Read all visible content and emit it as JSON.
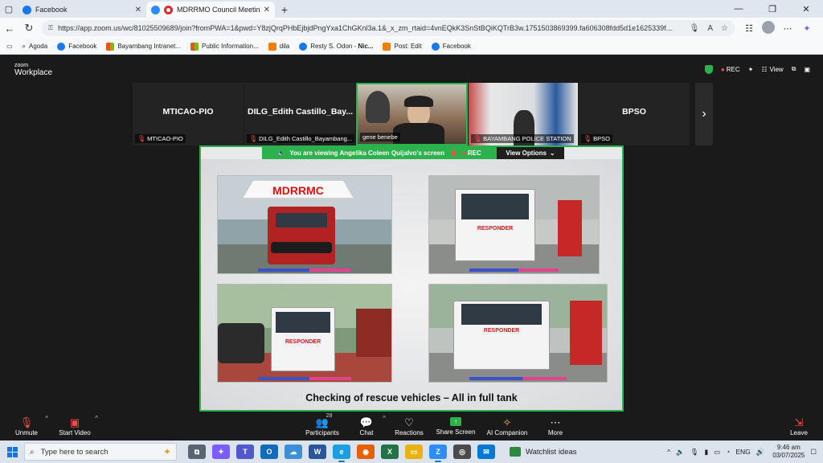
{
  "browser": {
    "tabs": [
      {
        "label": "Facebook",
        "close": "✕",
        "active": false,
        "color": "#1877f2"
      },
      {
        "label": "MDRRMO Council Meeting |",
        "close": "✕",
        "active": true,
        "color": "#2d8cff"
      }
    ],
    "new_tab": "+",
    "url": "https://app.zoom.us/wc/81025509689/join?fromPWA=1&pwd=Y8zjQrqPHbEjbjdPngYxa1ChGKnl3a.1&_x_zm_rtaid=4vnEQkK3SnStBQiKQTrB3w.1751503869399.fa606308fdd5d1e1625339f...",
    "bookmarks": [
      {
        "label": "Agoda",
        "icon": "search-icon",
        "color": "#888"
      },
      {
        "label": "Facebook",
        "icon": "facebook-icon",
        "color": "#1877f2"
      },
      {
        "label": "Bayambang Intranet...",
        "icon": "windows-icon",
        "color": "#f25022"
      },
      {
        "label": "Public Information...",
        "icon": "windows-icon",
        "color": "#f25022"
      },
      {
        "label": "dila",
        "icon": "blogger-icon",
        "color": "#f57d00"
      },
      {
        "label": "Resty S. Odon -",
        "bold": "Nic...",
        "icon": "facebook-icon",
        "color": "#1877f2"
      },
      {
        "label": "Post: Edit",
        "icon": "blogger-icon",
        "color": "#f57d00"
      },
      {
        "label": "Facebook",
        "icon": "facebook-icon",
        "color": "#1877f2"
      }
    ]
  },
  "zoom": {
    "logo_top": "zoom",
    "logo_bottom": "Workplace",
    "rec": "REC",
    "view": "View",
    "participants_strip": [
      {
        "name": "MTICAO-PIO",
        "label": "MTICAO-PIO",
        "video": false
      },
      {
        "name": "DILG_Edith Castillo_Bay...",
        "label": "DILG_Edith Castillo_Bayambang...",
        "video": false
      },
      {
        "name": "",
        "label": "gene benebe",
        "video": true
      },
      {
        "name": "",
        "label": "BAYAMBANG POLICE STATION",
        "video": true
      },
      {
        "name": "BPSO",
        "label": "BPSO",
        "video": false
      }
    ],
    "share_banner": "You are viewing  Angelika Coleen Quijalvo's screen",
    "share_rec": "REC",
    "view_options": "View Options",
    "slide": {
      "tent_text": "MDRRMC",
      "photo_tags": [
        "RESPONDER",
        "RESPONDER",
        "RESPONDER"
      ],
      "caption": "Checking of rescue vehicles – All in full tank"
    },
    "toolbar": {
      "unmute": "Unmute",
      "start_video": "Start Video",
      "participants": "Participants",
      "participants_count": "28",
      "chat": "Chat",
      "reactions": "Reactions",
      "share_screen": "Share Screen",
      "ai_companion": "AI Companion",
      "more": "More",
      "leave": "Leave"
    }
  },
  "taskbar": {
    "search_placeholder": "Type here to search",
    "watchlist": "Watchlist ideas",
    "lang": "ENG",
    "time": "9:46 am",
    "date": "03/07/2025"
  }
}
